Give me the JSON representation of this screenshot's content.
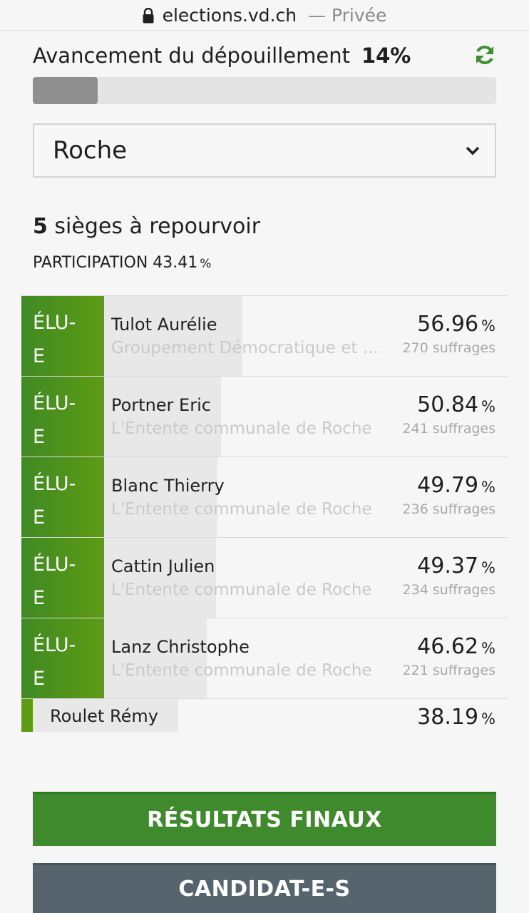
{
  "browser": {
    "domain": "elections.vd.ch",
    "separator": "—",
    "mode": "Privée"
  },
  "progress": {
    "label": "Avancement du dépouillement",
    "percent_text": "14%",
    "value": 0.14
  },
  "commune_select": {
    "selected": "Roche"
  },
  "summary": {
    "seats_number": "5",
    "seats_text": "sièges à repourvoir",
    "participation_label": "PARTICIPATION 43.41",
    "participation_unit": "%"
  },
  "candidates": [
    {
      "badge_line1": "ÉLU-",
      "badge_line2": "E",
      "name": "Tulot Aurélie",
      "party": "Groupement Démocratique et ...",
      "percent": "56.96",
      "unit": "%",
      "votes": "270 suffrages",
      "share": 0.5696
    },
    {
      "badge_line1": "ÉLU-",
      "badge_line2": "E",
      "name": "Portner Eric",
      "party": "L'Entente communale de Roche",
      "percent": "50.84",
      "unit": "%",
      "votes": "241 suffrages",
      "share": 0.5084
    },
    {
      "badge_line1": "ÉLU-",
      "badge_line2": "E",
      "name": "Blanc Thierry",
      "party": "L'Entente communale de Roche",
      "percent": "49.79",
      "unit": "%",
      "votes": "236 suffrages",
      "share": 0.4979
    },
    {
      "badge_line1": "ÉLU-",
      "badge_line2": "E",
      "name": "Cattin Julien",
      "party": "L'Entente communale de Roche",
      "percent": "49.37",
      "unit": "%",
      "votes": "234 suffrages",
      "share": 0.4937
    },
    {
      "badge_line1": "ÉLU-",
      "badge_line2": "E",
      "name": "Lanz Christophe",
      "party": "L'Entente communale de Roche",
      "percent": "46.62",
      "unit": "%",
      "votes": "221 suffrages",
      "share": 0.4662
    },
    {
      "name": "Roulet Rémy",
      "percent": "38.19",
      "unit": "%",
      "share": 0.3819
    }
  ],
  "buttons": {
    "final_results": "RÉSULTATS FINAUX",
    "candidates": "CANDIDAT-E-S"
  },
  "colors": {
    "elected_green": "#4f9220",
    "final_button": "#3f8a2c",
    "candidates_button": "#56656d",
    "progress_fill": "#8f8f8f"
  }
}
